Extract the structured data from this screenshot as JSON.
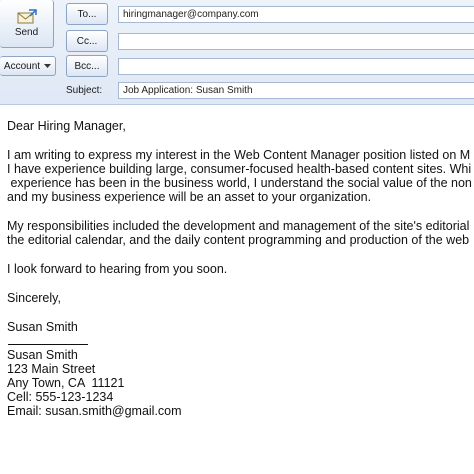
{
  "toolbar": {
    "send_label": "Send",
    "account_label": "Account",
    "to_label": "To...",
    "cc_label": "Cc...",
    "bcc_label": "Bcc...",
    "subject_label": "Subject:"
  },
  "fields": {
    "to": "hiringmanager@company.com",
    "cc": "",
    "bcc": "",
    "subject": "Job Application: Susan Smith"
  },
  "body": {
    "greeting": "Dear Hiring Manager,",
    "paragraph1": [
      "I am writing to express my interest in the Web Content Manager position listed on M",
      "I have experience building large, consumer-focused health-based content sites. Whi",
      " experience has been in the business world, I understand the social value of the non",
      "and my business experience will be an asset to your organization."
    ],
    "paragraph2": [
      "My responsibilities included the development and management of the site's editorial",
      "the editorial calendar, and the daily content programming and production of the web"
    ],
    "closing_line": "I look forward to hearing from you soon.",
    "sign_off": "Sincerely,",
    "signed_name": "Susan Smith"
  },
  "signature": {
    "name": "Susan Smith",
    "street": "123 Main Street",
    "city": "Any Town, CA  11121",
    "cell": "Cell: 555-123-1234",
    "email": "Email: susan.smith@gmail.com"
  },
  "icons": {
    "send": "envelope-send-icon",
    "account": "chevron-down-icon"
  },
  "colors": {
    "toolbar_bg": "#dfe8f5",
    "border": "#8ea4c4"
  }
}
